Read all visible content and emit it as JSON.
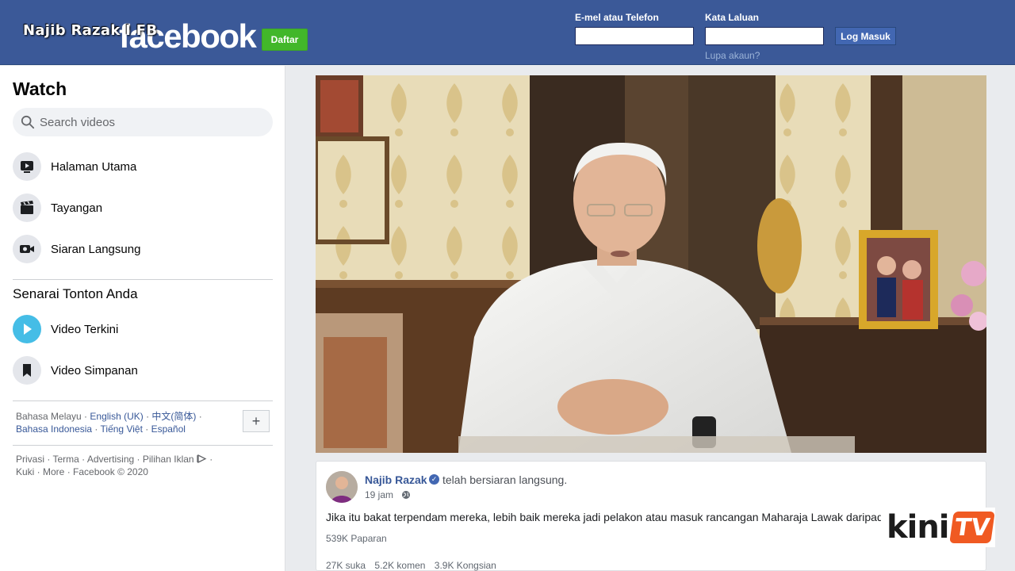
{
  "header": {
    "overlay_title": "Najib Razak I FB",
    "logo": "facebook",
    "signup_label": "Daftar",
    "email_label": "E-mel atau Telefon",
    "password_label": "Kata Laluan",
    "login_label": "Log Masuk",
    "forgot_label": "Lupa akaun?",
    "email_value": "",
    "password_value": ""
  },
  "sidebar": {
    "title": "Watch",
    "search_placeholder": "Search videos",
    "nav": [
      {
        "label": "Halaman Utama",
        "icon": "video-icon"
      },
      {
        "label": "Tayangan",
        "icon": "clapperboard-icon"
      },
      {
        "label": "Siaran Langsung",
        "icon": "live-camera-icon"
      }
    ],
    "section_title": "Senarai Tonton Anda",
    "watchlist": [
      {
        "label": "Video Terkini",
        "icon": "play-icon"
      },
      {
        "label": "Video Simpanan",
        "icon": "bookmark-icon"
      }
    ],
    "languages": {
      "current": "Bahasa Melayu",
      "others": [
        "English (UK)",
        "中文(简体)",
        "Bahasa Indonesia",
        "Tiếng Việt",
        "Español"
      ],
      "add_label": "+"
    },
    "footer": {
      "privacy": "Privasi",
      "terms": "Terma",
      "advertising": "Advertising",
      "ad_choices": "Pilihan Iklan",
      "cookies": "Kuki",
      "more": "More",
      "copyright": "Facebook © 2020"
    }
  },
  "post": {
    "author": "Najib Razak",
    "action": "telah bersiaran langsung.",
    "time": "19 jam",
    "text": "Jika itu bakat terpendam mereka, lebih baik mereka jadi pelakon atau masuk rancangan Maharaja Lawak daripad",
    "views": "539K Paparan",
    "likes": "27K suka",
    "comments": "5.2K komen",
    "shares": "3.9K Kongsian"
  },
  "watermark": {
    "brand": "kini",
    "suffix": "TV"
  },
  "colors": {
    "fb_blue": "#3b5998",
    "signup_green": "#42b72a",
    "link_blue": "#385898",
    "kinitv_orange": "#f05a22"
  }
}
